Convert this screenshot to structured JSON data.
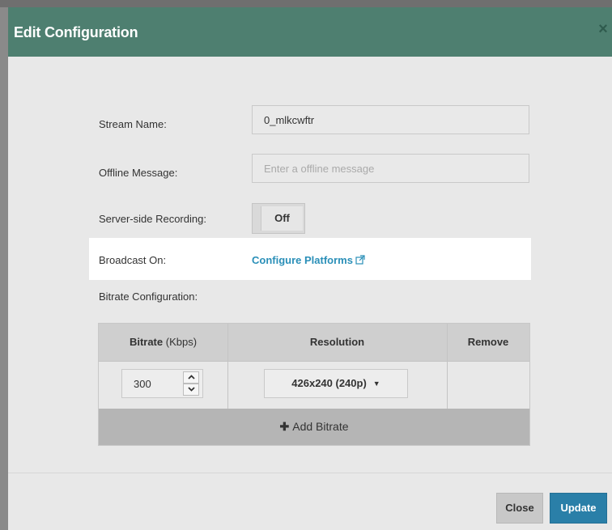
{
  "modal": {
    "title": "Edit Configuration",
    "close_glyph": "×"
  },
  "form": {
    "stream_name_label": "Stream Name:",
    "stream_name_value": "0_mlkcwftr",
    "offline_message_label": "Offline Message:",
    "offline_message_placeholder": "Enter a offline message",
    "recording_label": "Server-side Recording:",
    "recording_state": "Off",
    "broadcast_label": "Broadcast On:",
    "broadcast_link": "Configure Platforms",
    "bitrate_config_label": "Bitrate Configuration:"
  },
  "bitrate_table": {
    "headers": {
      "bitrate": "Bitrate",
      "bitrate_unit": "(Kbps)",
      "resolution": "Resolution",
      "remove": "Remove"
    },
    "rows": [
      {
        "bitrate": "300",
        "resolution": "426x240 (240p)"
      }
    ],
    "add_label": "Add Bitrate"
  },
  "footer": {
    "close_label": "Close",
    "update_label": "Update"
  },
  "colors": {
    "header": "#4e7f70",
    "link": "#2a8fb8",
    "primary_button": "#2a7fa8"
  },
  "icons": {
    "external_link": "external-link-icon",
    "spinner_up": "chevron-up-icon",
    "spinner_down": "chevron-down-icon",
    "dropdown": "caret-down-icon",
    "add": "plus-icon"
  }
}
